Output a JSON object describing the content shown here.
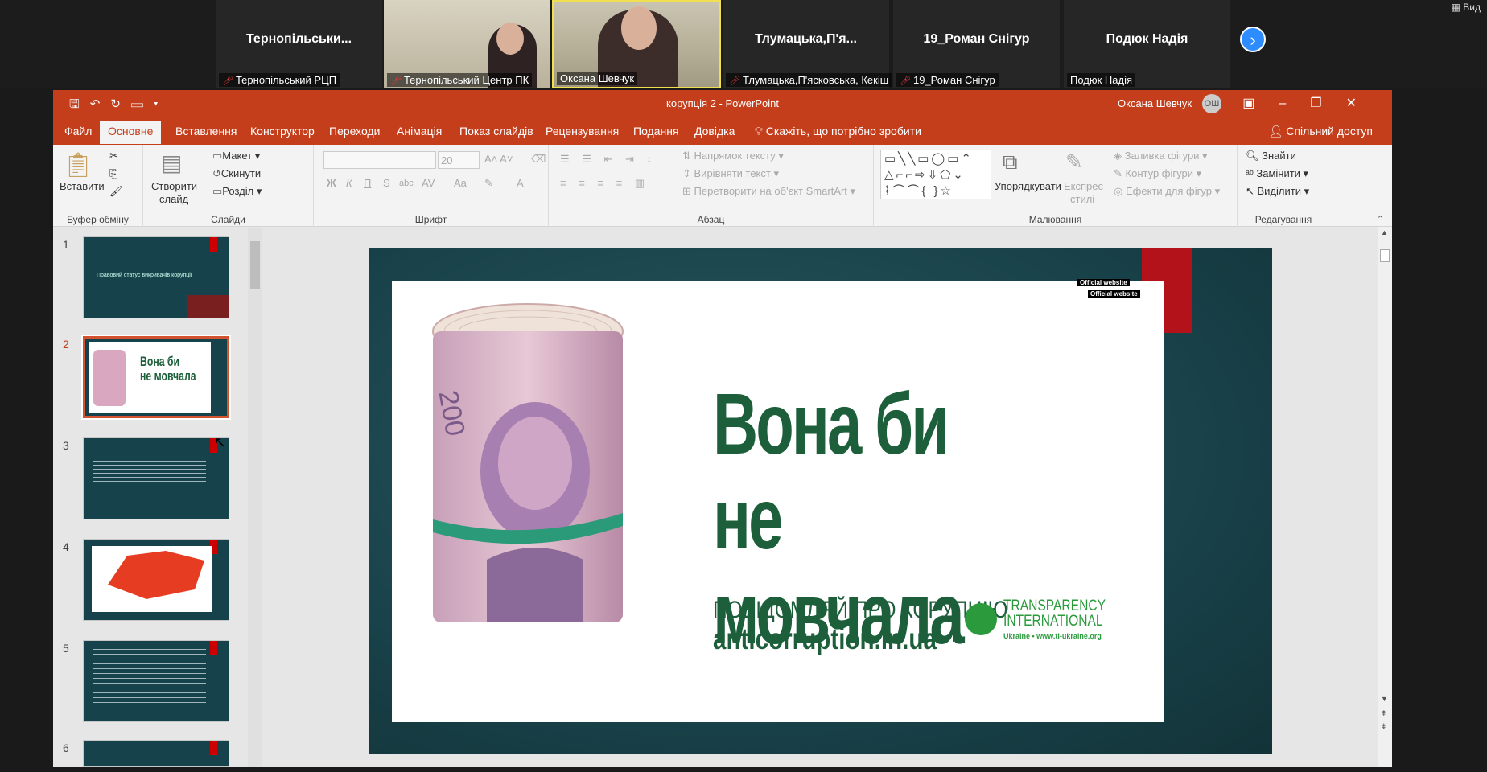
{
  "zoom_gallery": {
    "tiles": [
      {
        "name": "Тернопільськи...",
        "label": "Тернопільський РЦП",
        "muted": true
      },
      {
        "name": "",
        "label": "Тернопільський Центр ПК",
        "muted": true,
        "video": true
      },
      {
        "name": "",
        "label": "Оксана Шевчук",
        "muted": false,
        "video": true
      },
      {
        "name": "Тлумацька,П'я...",
        "label": "Тлумацька,П'ясковська, Кекіш",
        "muted": true
      },
      {
        "name": "19_Роман Снігур",
        "label": "19_Роман Снігур",
        "muted": true
      },
      {
        "name": "Подюк Надія",
        "label": "Подюк Надія",
        "muted": false
      }
    ],
    "next_icon": "chevron-right-icon",
    "view_label": "Вид"
  },
  "powerpoint": {
    "doc_title": "корупція 2  -  PowerPoint",
    "user_name": "Оксана Шевчук",
    "user_initials": "ОШ",
    "tabs": [
      "Файл",
      "Основне",
      "Вставлення",
      "Конструктор",
      "Переходи",
      "Анімація",
      "Показ слайдів",
      "Рецензування",
      "Подання",
      "Довідка"
    ],
    "active_tab": "Основне",
    "tell_me": "Скажіть, що потрібно зробити",
    "share": "Спільний доступ",
    "ribbon": {
      "clipboard": {
        "label": "Буфер обміну",
        "paste": "Вставити"
      },
      "slides": {
        "label": "Слайди",
        "new_slide_1": "Створити",
        "new_slide_2": "слайд",
        "layout": "Макет",
        "reset": "Скинути",
        "section": "Розділ"
      },
      "font": {
        "label": "Шрифт",
        "size": "20",
        "bold": "Ж",
        "italic": "К",
        "underline": "П",
        "shadow": "S",
        "strike": "abc",
        "spacing": "AV",
        "case": "Aa",
        "color": "A"
      },
      "paragraph": {
        "label": "Абзац",
        "text_direction": "Напрямок тексту",
        "align_text": "Вирівняти текст",
        "smartart": "Перетворити на об'єкт SmartArt"
      },
      "drawing": {
        "label": "Малювання",
        "arrange": "Упорядкувати",
        "quick_styles_1": "Експрес-",
        "quick_styles_2": "стилі",
        "fill": "Заливка фігури",
        "outline": "Контур фігури",
        "effects": "Ефекти для фігур"
      },
      "editing": {
        "label": "Редагування",
        "find": "Знайти",
        "replace": "Замінити",
        "select": "Виділити"
      }
    },
    "slides": [
      {
        "num": "1",
        "text": "Правовий статус викривачів корупції"
      },
      {
        "num": "2",
        "text": ""
      },
      {
        "num": "3",
        "text": ""
      },
      {
        "num": "4",
        "text": ""
      },
      {
        "num": "5",
        "text": ""
      },
      {
        "num": "6",
        "text": ""
      }
    ],
    "selected_slide": 2,
    "current_slide": {
      "headline_line1": "Вона би",
      "headline_line2": "не мовчала",
      "report_line": "ПОВІДОМЛЯЙ ПРО КОРУПЦІЮ",
      "website": "anticorruption.in.ua",
      "org_name": "TRANSPARENCY\nINTERNATIONAL",
      "org_country_url": "Ukraine  •  www.ti-ukraine.org",
      "official_tag_1": "Official website",
      "official_tag_2": "Official website"
    },
    "accent_color": "#c43e1c"
  }
}
